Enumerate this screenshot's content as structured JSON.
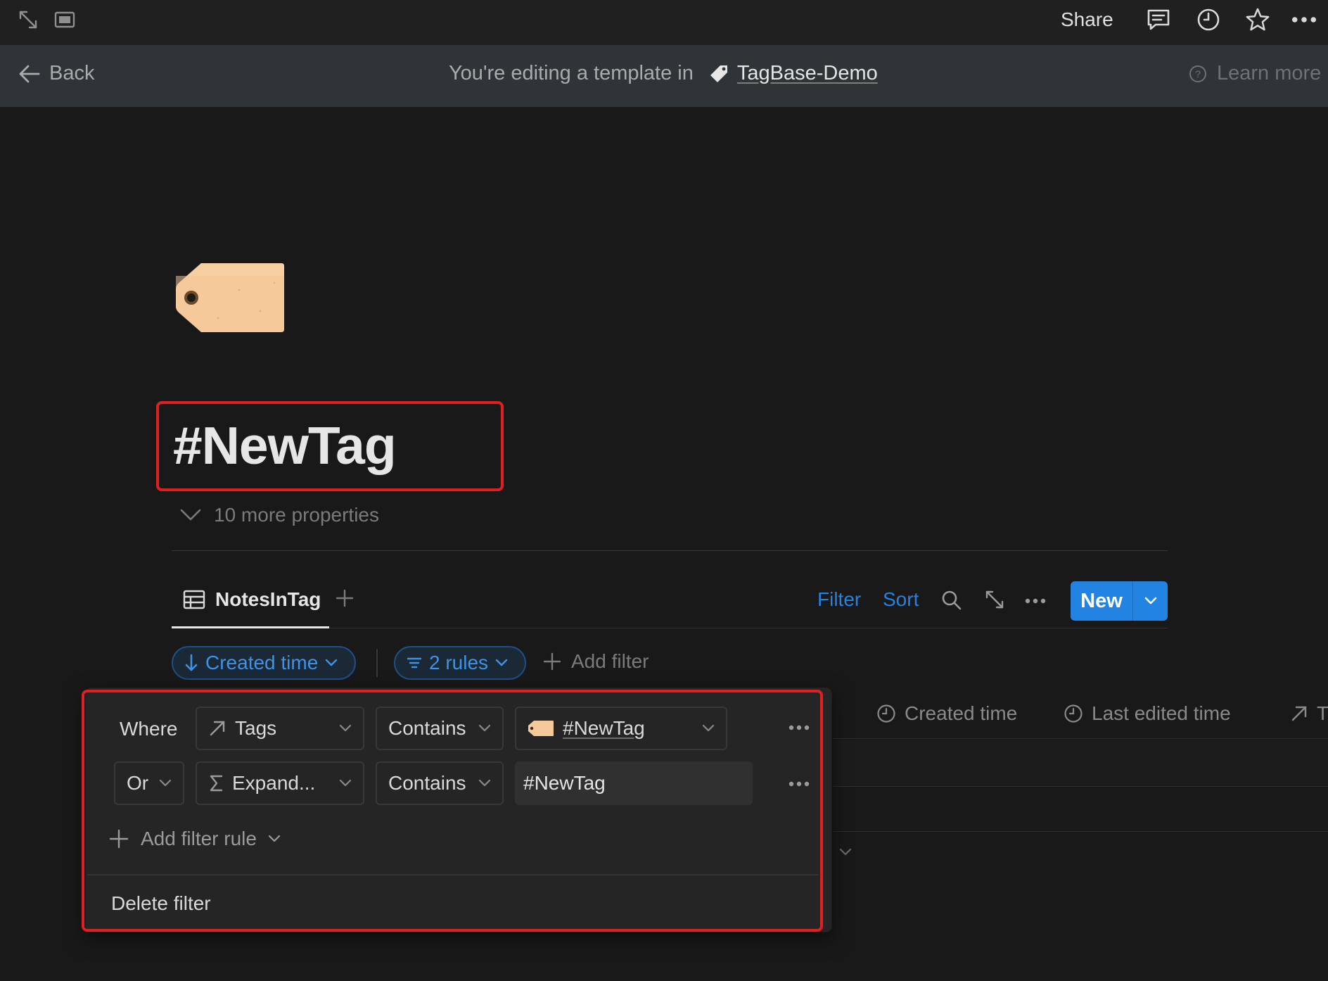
{
  "topbar": {
    "share_label": "Share",
    "icons": [
      "expand-icon",
      "sidebar-panel-icon",
      "comment-icon",
      "history-clock-icon",
      "star-icon",
      "more-icon"
    ]
  },
  "banner": {
    "back_label": "Back",
    "editing_text": "You're editing a template in",
    "database_name": "TagBase-Demo",
    "learn_more_label": "Learn more"
  },
  "page": {
    "icon": "tag-emoji",
    "title": "#NewTag",
    "more_properties": "10 more properties"
  },
  "database": {
    "view_tab_label": "NotesInTag",
    "filter_label": "Filter",
    "sort_label": "Sort",
    "new_label": "New",
    "sort_chip_label": "Created time",
    "rules_chip_label": "2 rules",
    "add_filter_label": "Add filter",
    "columns": [
      {
        "label": "Created time",
        "icon": "clock-icon"
      },
      {
        "label": "Last edited time",
        "icon": "clock-icon"
      },
      {
        "label": "T",
        "icon": "relation-arrow-icon"
      }
    ]
  },
  "filter_popup": {
    "where_label": "Where",
    "rules": [
      {
        "connector": "Where",
        "property": "Tags",
        "property_icon": "relation-arrow-icon",
        "operator": "Contains",
        "value": "#NewTag",
        "value_kind": "relation-chip"
      },
      {
        "connector": "Or",
        "property": "Expand...",
        "property_icon": "formula-sigma-icon",
        "operator": "Contains",
        "value": "#NewTag",
        "value_kind": "text"
      }
    ],
    "add_rule_label": "Add filter rule",
    "delete_label": "Delete filter"
  },
  "colors": {
    "background": "#191919",
    "banner": "#2f3437",
    "accent_blue": "#2383e2",
    "highlight_red": "#e02020",
    "tag_fill": "#f6c99a"
  }
}
